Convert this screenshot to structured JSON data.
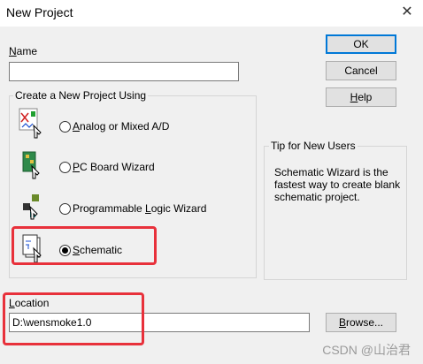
{
  "window": {
    "title": "New Project",
    "close_glyph": "✕"
  },
  "name_field": {
    "label": "Name",
    "value": ""
  },
  "buttons": {
    "ok": "OK",
    "cancel": "Cancel",
    "help": "Help",
    "browse": "Browse..."
  },
  "project_type": {
    "legend": "Create a New Project Using",
    "options": [
      {
        "label": "Analog or Mixed A/D",
        "icon": "analog-circuit-icon",
        "selected": false
      },
      {
        "label": "PC Board Wizard",
        "icon": "pcb-board-icon",
        "selected": false
      },
      {
        "label": "Programmable Logic Wizard",
        "icon": "programmable-logic-icon",
        "selected": false
      },
      {
        "label": "Schematic",
        "icon": "schematic-page-icon",
        "selected": true
      }
    ]
  },
  "tip": {
    "legend": "Tip for New Users",
    "text": "Schematic Wizard is the fastest way to create blank schematic project."
  },
  "location": {
    "label": "Location",
    "value": "D:\\wensmoke1.0"
  },
  "watermark": "CSDN @山治君",
  "colors": {
    "annotation_red": "#e8313b",
    "default_button_border": "#0078d7"
  }
}
